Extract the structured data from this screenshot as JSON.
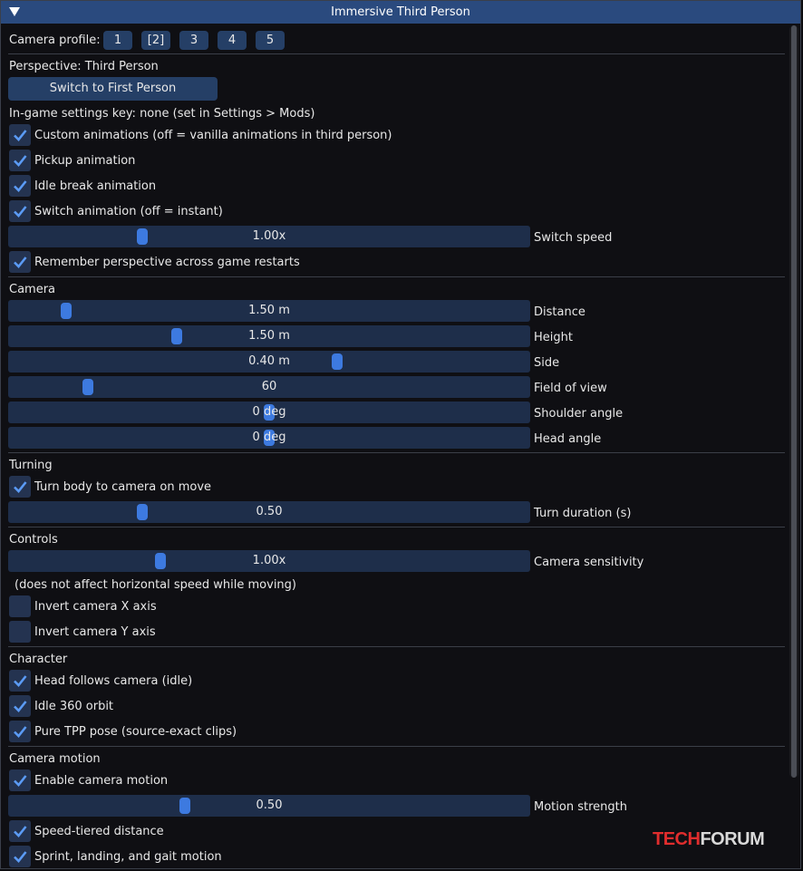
{
  "window": {
    "title": "Immersive Third Person"
  },
  "profile": {
    "label": "Camera profile:",
    "buttons": [
      "1",
      "[2]",
      "3",
      "4",
      "5"
    ]
  },
  "perspective": {
    "label": "Perspective: Third Person",
    "switch_button": "Switch to First Person",
    "settings_key": "In-game settings key: none (set in Settings > Mods)",
    "custom_animations": "Custom animations (off = vanilla animations in third person)",
    "pickup_animation": "Pickup animation",
    "idle_break": "Idle break animation",
    "switch_animation": "Switch animation (off = instant)",
    "switch_speed": {
      "value": "1.00x",
      "label": "Switch speed"
    },
    "remember": "Remember perspective across game restarts"
  },
  "camera": {
    "header": "Camera",
    "distance": {
      "value": "1.50 m",
      "label": "Distance"
    },
    "height": {
      "value": "1.50 m",
      "label": "Height"
    },
    "side": {
      "value": "0.40 m",
      "label": "Side"
    },
    "fov": {
      "value": "60",
      "label": "Field of view"
    },
    "shoulder": {
      "value": "0 deg",
      "label": "Shoulder angle"
    },
    "head": {
      "value": "0 deg",
      "label": "Head angle"
    }
  },
  "turning": {
    "header": "Turning",
    "turn_body": "Turn body to camera on move",
    "turn_duration": {
      "value": "0.50",
      "label": "Turn duration (s)"
    }
  },
  "controls": {
    "header": "Controls",
    "sensitivity": {
      "value": "1.00x",
      "label": "Camera sensitivity"
    },
    "note": "(does not affect horizontal speed while moving)",
    "invert_x": "Invert camera X axis",
    "invert_y": "Invert camera Y axis"
  },
  "character": {
    "header": "Character",
    "head_follows": "Head follows camera (idle)",
    "idle_orbit": "Idle 360 orbit",
    "pure_tpp": "Pure TPP pose (source-exact clips)"
  },
  "motion": {
    "header": "Camera motion",
    "enable": "Enable camera motion",
    "strength": {
      "value": "0.50",
      "label": "Motion strength"
    },
    "speed_tiered": "Speed-tiered distance",
    "sprint": "Sprint, landing, and gait motion"
  },
  "watermark": {
    "part1": "TECH",
    "part2": "FORUM"
  },
  "colors": {
    "accent": "#3d7ae0",
    "title_bar": "#2a4a7e",
    "frame": "#1e2e4a"
  }
}
